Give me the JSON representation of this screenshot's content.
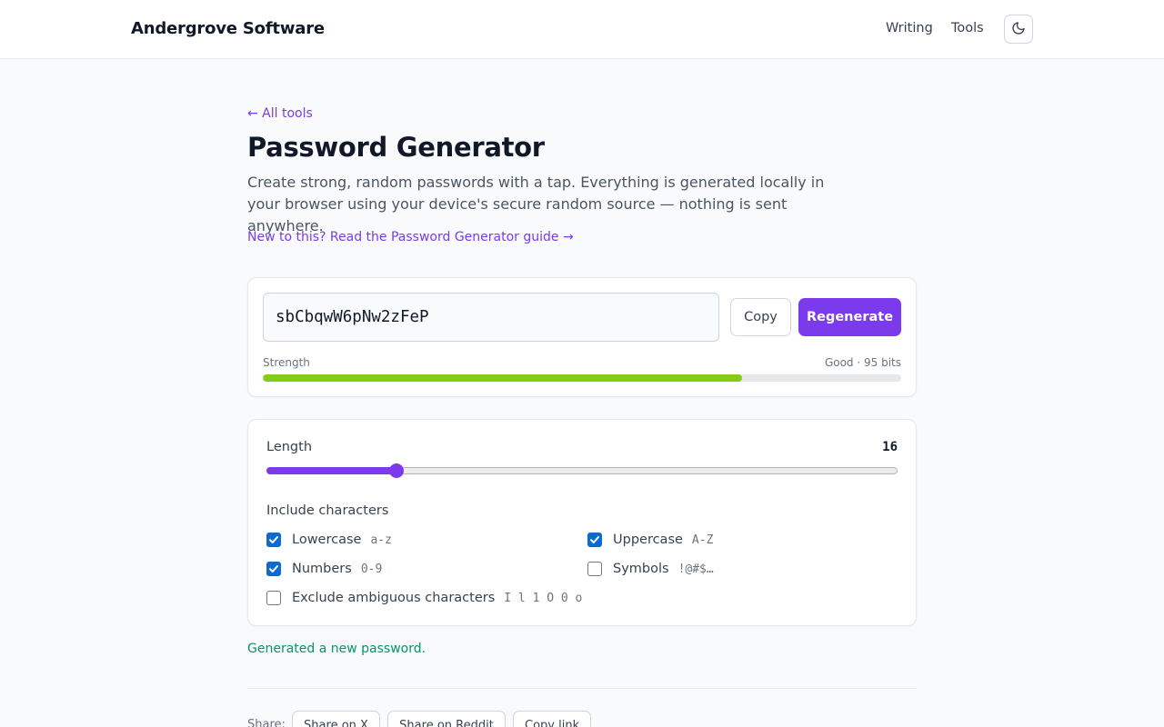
{
  "header": {
    "brand": "Andergrove Software",
    "nav": {
      "writing": "Writing",
      "tools": "Tools"
    },
    "theme_toggle_icon": "moon-icon"
  },
  "page": {
    "back_link": "← All tools",
    "title": "Password Generator",
    "intro": "Create strong, random passwords with a tap. Everything is generated locally in your browser using your device's secure random source — nothing is sent anywhere.",
    "guide_link": "New to this? Read the Password Generator guide →"
  },
  "generator": {
    "password": "sbCbqwW6pNw2zFeP",
    "copy_label": "Copy",
    "regenerate_label": "Regenerate",
    "strength_label": "Strength",
    "strength_value": "Good · 95 bits",
    "strength_fraction": 0.75,
    "strength_color": "#84cc16"
  },
  "options": {
    "length_label": "Length",
    "length_value": "16",
    "length_slider_fraction": 0.206,
    "include_label": "Include characters",
    "lowercase": {
      "label": "Lowercase",
      "hint": "a-z",
      "checked": true
    },
    "uppercase": {
      "label": "Uppercase",
      "hint": "A-Z",
      "checked": true
    },
    "numbers": {
      "label": "Numbers",
      "hint": "0-9",
      "checked": true
    },
    "symbols": {
      "label": "Symbols",
      "hint": "!@#$…",
      "checked": false
    },
    "ambiguous": {
      "label": "Exclude ambiguous characters",
      "hint": "I l 1 O 0 o",
      "checked": false
    }
  },
  "status_message": "Generated a new password.",
  "share": {
    "label": "Share:",
    "x": "Share on X",
    "reddit": "Share on Reddit",
    "copy_link": "Copy link"
  },
  "colors": {
    "accent": "#7c3aed",
    "success": "#059669",
    "checkbox": "#0b6bd3"
  }
}
